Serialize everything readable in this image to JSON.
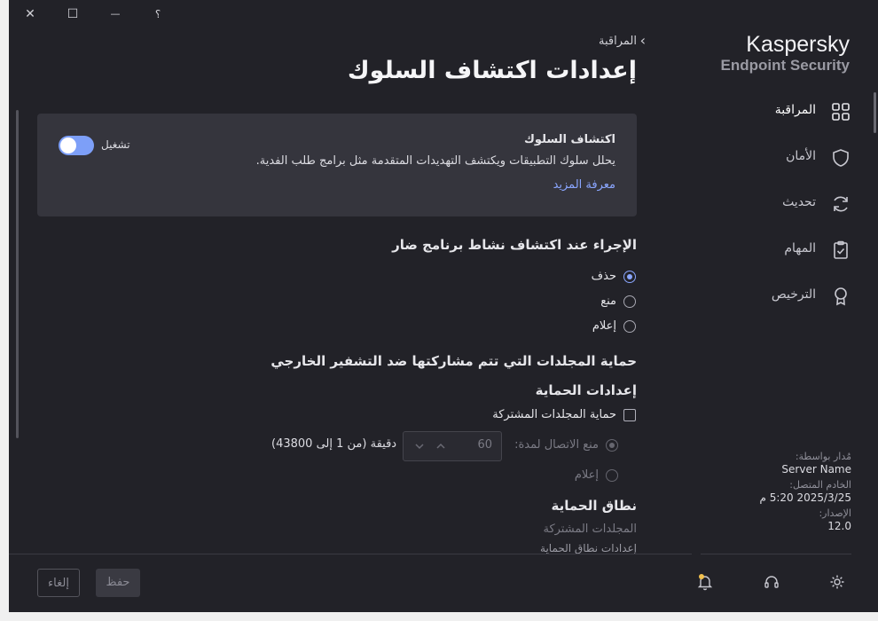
{
  "titlebar": {
    "close_icon": "✕",
    "maximize_icon": "☐",
    "minimize_icon": "—",
    "help_icon": "؟"
  },
  "brand": {
    "line1": "Kaspersky",
    "line2": "Endpoint Security"
  },
  "sidebar": {
    "items": [
      {
        "label": "المراقبة",
        "icon": "grid-icon"
      },
      {
        "label": "الأمان",
        "icon": "shield-icon"
      },
      {
        "label": "تحديث",
        "icon": "refresh-icon"
      },
      {
        "label": "المهام",
        "icon": "clipboard-icon"
      },
      {
        "label": "الترخيص",
        "icon": "award-icon"
      }
    ],
    "info": {
      "managed_by_label": "مُدار بواسطة:",
      "managed_by_value": "Server Name",
      "connected_label": "الخادم المتصل:",
      "connected_value": "2025/3/25 5:20 م",
      "version_label": "الإصدار:",
      "version_value": "12.0"
    }
  },
  "breadcrumb": {
    "label": "المراقبة"
  },
  "page": {
    "title": "إعدادات اكتشاف السلوك"
  },
  "card": {
    "title": "اكتشاف السلوك",
    "description": "يحلل سلوك التطبيقات ويكتشف التهديدات المتقدمة مثل برامج طلب الفدية.",
    "link": "معرفة المزيد",
    "toggle_label": "تشغيل",
    "toggle_on": true
  },
  "action": {
    "heading": "الإجراء عند اكتشاف نشاط برنامج ضار",
    "options": [
      "حذف",
      "منع",
      "إعلام"
    ],
    "selected": "حذف"
  },
  "shared": {
    "heading": "حماية المجلدات التي تتم مشاركتها ضد التشفير الخارجي",
    "settings_heading": "إعدادات الحماية",
    "checkbox_label": "حماية المجلدات المشتركة",
    "block_label": "منع الاتصال لمدة:",
    "block_value": "60",
    "block_unit": "دقيقة (من 1 إلى 43800)",
    "notify_label": "إعلام",
    "scope_heading": "نطاق الحماية",
    "scope_item": "المجلدات المشتركة",
    "scope_settings": "إعدادات نطاق الحماية"
  },
  "footer": {
    "save": "حفظ",
    "cancel": "إلغاء",
    "notifications_icon": "bell-icon",
    "support_icon": "headset-icon",
    "settings_icon": "gear-icon"
  },
  "colors": {
    "accent": "#8aa6ff",
    "background": "#222228",
    "card": "#35353d"
  }
}
